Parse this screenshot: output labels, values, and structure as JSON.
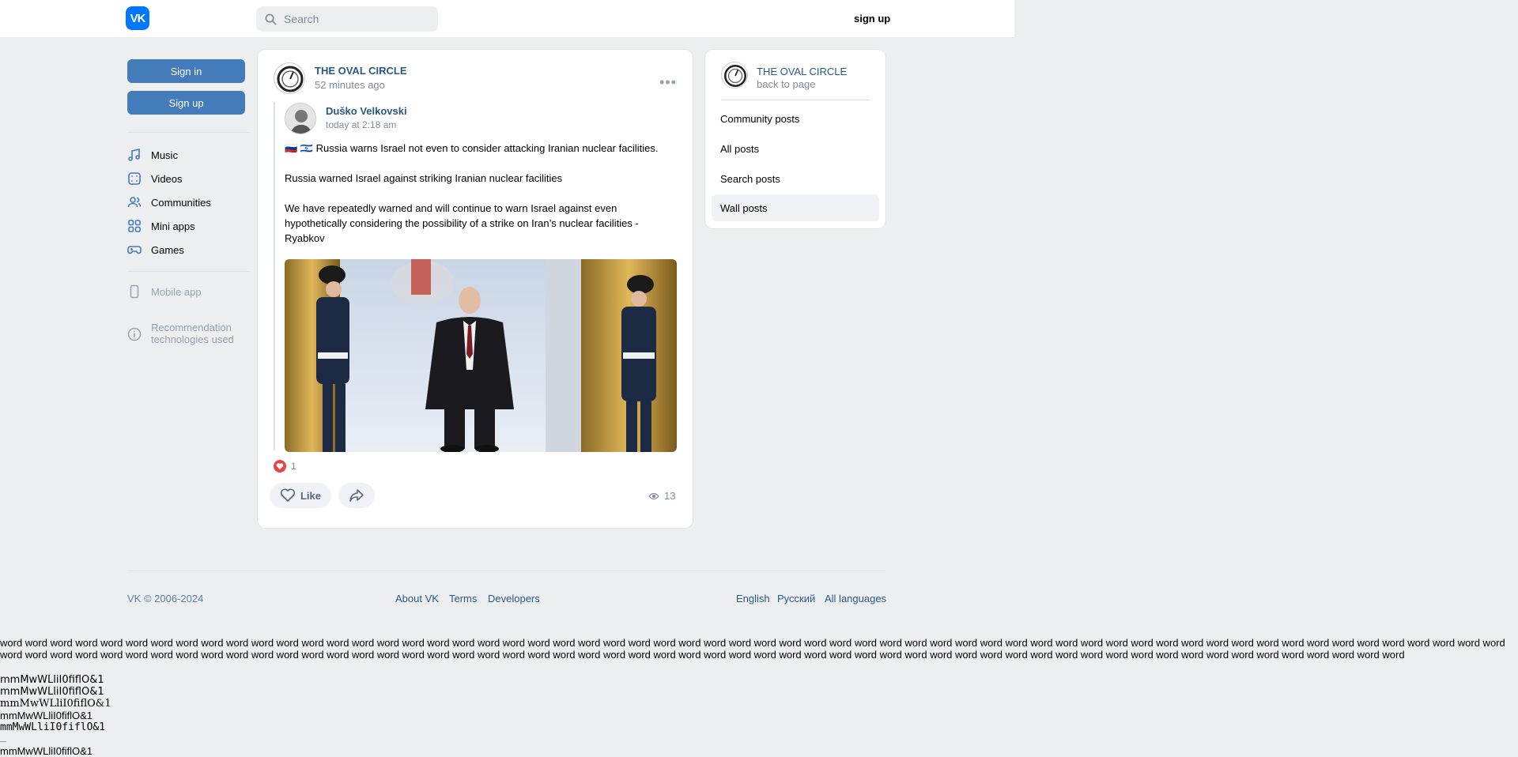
{
  "header": {
    "logo_text": "VK",
    "search_placeholder": "Search",
    "signup_label": "sign up"
  },
  "left_nav": {
    "signin_label": "Sign in",
    "signup_label": "Sign up",
    "items": [
      {
        "label": "Music",
        "icon": "music-icon"
      },
      {
        "label": "Videos",
        "icon": "videos-icon"
      },
      {
        "label": "Communities",
        "icon": "communities-icon"
      },
      {
        "label": "Mini apps",
        "icon": "mini-apps-icon"
      },
      {
        "label": "Games",
        "icon": "games-icon"
      }
    ],
    "mobile_app": "Mobile app",
    "recommendation_line1": "Recommendation",
    "recommendation_line2": "technologies used"
  },
  "post": {
    "group_name": "THE OVAL CIRCLE",
    "time": "52 minutes ago",
    "repost": {
      "author": "Duško Velkovski",
      "time": "today at 2:18 am",
      "paragraph1": "🇷🇺 🇮🇱 Russia warns Israel not even to consider attacking Iranian nuclear facilities.",
      "paragraph2": "Russia warned Israel against striking Iranian nuclear facilities",
      "paragraph3": "We have repeatedly warned and will continue to warn Israel against even hypothetically considering the possibility of a strike on Iran’s nuclear facilities - Ryabkov"
    },
    "likes_count": "1",
    "like_label": "Like",
    "views_count": "13"
  },
  "side_menu": {
    "group_name": "THE OVAL CIRCLE",
    "back_label": "back to page",
    "items": [
      "Community posts",
      "All posts",
      "Search posts",
      "Wall posts"
    ]
  },
  "footer": {
    "copyright": "VK © 2006-2024",
    "about": "About VK",
    "terms": "Terms",
    "developers": "Developers",
    "lang_english": "English",
    "lang_russian": "Русский",
    "lang_all": "All languages"
  },
  "debug": {
    "words_text": "word word word word word word word word word word word word word word word word word word word word word word word word word word word word word word word word word word word word word word word word word word word word word word word word word word word word word word word word word word word word word word word word word word word word word word word word word word word word word word word word word word word word word word word word word word word word word word word word word word word word word word word word word word word word word word word word word word word word",
    "mono_lines": [
      "mmMwWLliI0fiflO&1",
      "mmMwWLliI0fiflO&1",
      "mmMwWLliI0fiflO&1",
      "mmMwWLliI0fiflO&1",
      "mmMwWLliI0fiflO&1",
      "mmMwWLliI0fiflO&1"
    ]
  }
}
